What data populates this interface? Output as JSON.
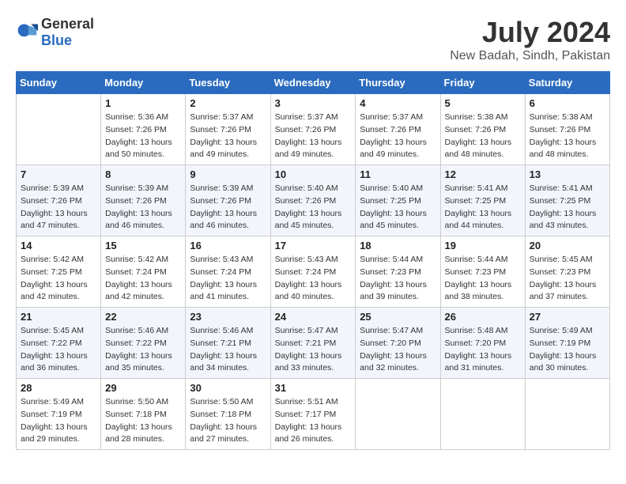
{
  "header": {
    "logo_general": "General",
    "logo_blue": "Blue",
    "month_year": "July 2024",
    "location": "New Badah, Sindh, Pakistan"
  },
  "weekdays": [
    "Sunday",
    "Monday",
    "Tuesday",
    "Wednesday",
    "Thursday",
    "Friday",
    "Saturday"
  ],
  "weeks": [
    [
      {
        "day": "",
        "info": ""
      },
      {
        "day": "1",
        "info": "Sunrise: 5:36 AM\nSunset: 7:26 PM\nDaylight: 13 hours\nand 50 minutes."
      },
      {
        "day": "2",
        "info": "Sunrise: 5:37 AM\nSunset: 7:26 PM\nDaylight: 13 hours\nand 49 minutes."
      },
      {
        "day": "3",
        "info": "Sunrise: 5:37 AM\nSunset: 7:26 PM\nDaylight: 13 hours\nand 49 minutes."
      },
      {
        "day": "4",
        "info": "Sunrise: 5:37 AM\nSunset: 7:26 PM\nDaylight: 13 hours\nand 49 minutes."
      },
      {
        "day": "5",
        "info": "Sunrise: 5:38 AM\nSunset: 7:26 PM\nDaylight: 13 hours\nand 48 minutes."
      },
      {
        "day": "6",
        "info": "Sunrise: 5:38 AM\nSunset: 7:26 PM\nDaylight: 13 hours\nand 48 minutes."
      }
    ],
    [
      {
        "day": "7",
        "info": "Sunrise: 5:39 AM\nSunset: 7:26 PM\nDaylight: 13 hours\nand 47 minutes."
      },
      {
        "day": "8",
        "info": "Sunrise: 5:39 AM\nSunset: 7:26 PM\nDaylight: 13 hours\nand 46 minutes."
      },
      {
        "day": "9",
        "info": "Sunrise: 5:39 AM\nSunset: 7:26 PM\nDaylight: 13 hours\nand 46 minutes."
      },
      {
        "day": "10",
        "info": "Sunrise: 5:40 AM\nSunset: 7:26 PM\nDaylight: 13 hours\nand 45 minutes."
      },
      {
        "day": "11",
        "info": "Sunrise: 5:40 AM\nSunset: 7:25 PM\nDaylight: 13 hours\nand 45 minutes."
      },
      {
        "day": "12",
        "info": "Sunrise: 5:41 AM\nSunset: 7:25 PM\nDaylight: 13 hours\nand 44 minutes."
      },
      {
        "day": "13",
        "info": "Sunrise: 5:41 AM\nSunset: 7:25 PM\nDaylight: 13 hours\nand 43 minutes."
      }
    ],
    [
      {
        "day": "14",
        "info": "Sunrise: 5:42 AM\nSunset: 7:25 PM\nDaylight: 13 hours\nand 42 minutes."
      },
      {
        "day": "15",
        "info": "Sunrise: 5:42 AM\nSunset: 7:24 PM\nDaylight: 13 hours\nand 42 minutes."
      },
      {
        "day": "16",
        "info": "Sunrise: 5:43 AM\nSunset: 7:24 PM\nDaylight: 13 hours\nand 41 minutes."
      },
      {
        "day": "17",
        "info": "Sunrise: 5:43 AM\nSunset: 7:24 PM\nDaylight: 13 hours\nand 40 minutes."
      },
      {
        "day": "18",
        "info": "Sunrise: 5:44 AM\nSunset: 7:23 PM\nDaylight: 13 hours\nand 39 minutes."
      },
      {
        "day": "19",
        "info": "Sunrise: 5:44 AM\nSunset: 7:23 PM\nDaylight: 13 hours\nand 38 minutes."
      },
      {
        "day": "20",
        "info": "Sunrise: 5:45 AM\nSunset: 7:23 PM\nDaylight: 13 hours\nand 37 minutes."
      }
    ],
    [
      {
        "day": "21",
        "info": "Sunrise: 5:45 AM\nSunset: 7:22 PM\nDaylight: 13 hours\nand 36 minutes."
      },
      {
        "day": "22",
        "info": "Sunrise: 5:46 AM\nSunset: 7:22 PM\nDaylight: 13 hours\nand 35 minutes."
      },
      {
        "day": "23",
        "info": "Sunrise: 5:46 AM\nSunset: 7:21 PM\nDaylight: 13 hours\nand 34 minutes."
      },
      {
        "day": "24",
        "info": "Sunrise: 5:47 AM\nSunset: 7:21 PM\nDaylight: 13 hours\nand 33 minutes."
      },
      {
        "day": "25",
        "info": "Sunrise: 5:47 AM\nSunset: 7:20 PM\nDaylight: 13 hours\nand 32 minutes."
      },
      {
        "day": "26",
        "info": "Sunrise: 5:48 AM\nSunset: 7:20 PM\nDaylight: 13 hours\nand 31 minutes."
      },
      {
        "day": "27",
        "info": "Sunrise: 5:49 AM\nSunset: 7:19 PM\nDaylight: 13 hours\nand 30 minutes."
      }
    ],
    [
      {
        "day": "28",
        "info": "Sunrise: 5:49 AM\nSunset: 7:19 PM\nDaylight: 13 hours\nand 29 minutes."
      },
      {
        "day": "29",
        "info": "Sunrise: 5:50 AM\nSunset: 7:18 PM\nDaylight: 13 hours\nand 28 minutes."
      },
      {
        "day": "30",
        "info": "Sunrise: 5:50 AM\nSunset: 7:18 PM\nDaylight: 13 hours\nand 27 minutes."
      },
      {
        "day": "31",
        "info": "Sunrise: 5:51 AM\nSunset: 7:17 PM\nDaylight: 13 hours\nand 26 minutes."
      },
      {
        "day": "",
        "info": ""
      },
      {
        "day": "",
        "info": ""
      },
      {
        "day": "",
        "info": ""
      }
    ]
  ]
}
